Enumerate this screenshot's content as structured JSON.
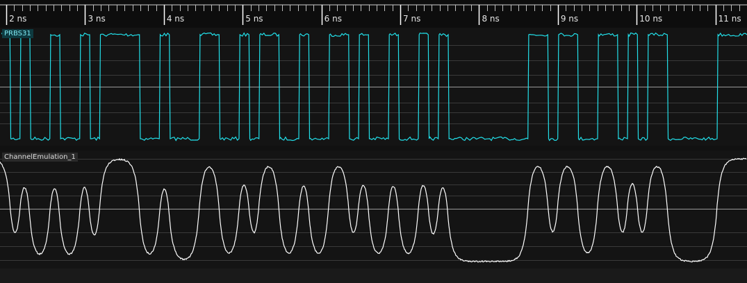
{
  "timeline": {
    "ticks": [
      "2 ns",
      "3 ns",
      "4 ns",
      "5 ns",
      "6 ns",
      "7 ns",
      "8 ns",
      "9 ns",
      "10 ns",
      "11 ns"
    ]
  },
  "channels": [
    {
      "label": "PRBS31",
      "color": "#22e0ea"
    },
    {
      "label": "ChannelEmulation_1",
      "color": "#ffffff"
    }
  ],
  "chart_data": {
    "type": "line",
    "x_units": "ns",
    "x_range": [
      1.92,
      11.4
    ],
    "series": [
      {
        "name": "PRBS31",
        "bits": [
          1,
          0,
          1,
          0,
          0,
          1,
          0,
          0,
          1,
          0,
          1,
          1,
          1,
          1,
          0,
          0,
          1,
          0,
          0,
          0,
          1,
          1,
          0,
          0,
          1,
          0,
          1,
          1,
          0,
          0,
          1,
          0,
          0,
          1,
          1,
          0,
          1,
          0,
          0,
          1,
          0,
          0,
          1,
          0,
          1,
          0,
          0,
          0,
          0,
          0,
          0,
          0,
          0,
          1,
          1,
          0,
          1,
          1,
          0,
          0,
          1,
          1,
          0,
          1,
          0,
          1,
          1,
          0,
          0,
          0,
          0,
          0,
          1,
          1,
          1
        ]
      },
      {
        "name": "ChannelEmulation_1",
        "bits": [
          1,
          0,
          1,
          0,
          0,
          1,
          0,
          0,
          1,
          0,
          1,
          1,
          1,
          1,
          0,
          0,
          1,
          0,
          0,
          0,
          1,
          1,
          0,
          0,
          1,
          0,
          1,
          1,
          0,
          0,
          1,
          0,
          0,
          1,
          1,
          0,
          1,
          0,
          0,
          1,
          0,
          0,
          1,
          0,
          1,
          0,
          0,
          0,
          0,
          0,
          0,
          0,
          0,
          1,
          1,
          0,
          1,
          1,
          0,
          0,
          1,
          1,
          0,
          1,
          0,
          1,
          1,
          0,
          0,
          0,
          0,
          0,
          1,
          1,
          1
        ]
      }
    ]
  }
}
